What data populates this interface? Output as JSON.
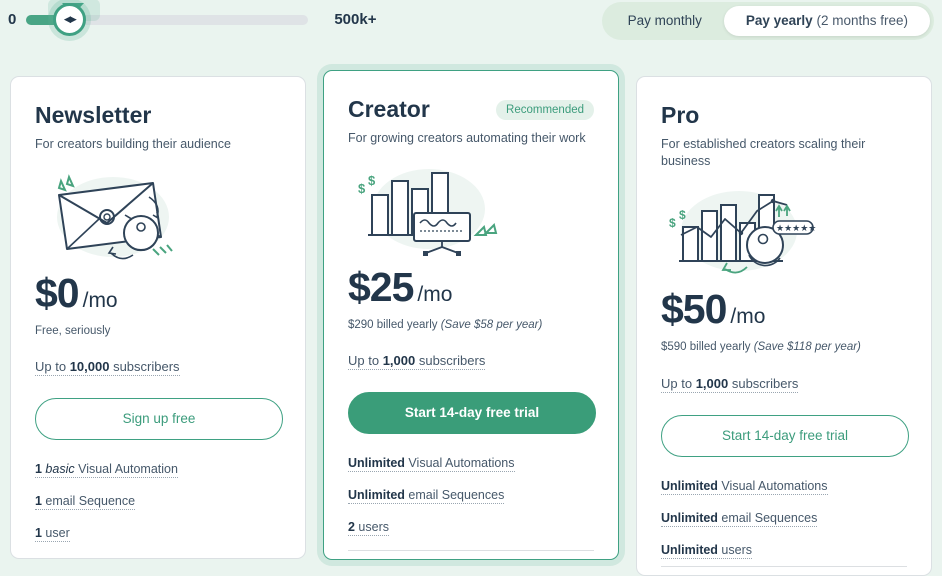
{
  "slider": {
    "min_label": "0",
    "max_label": "500k+",
    "thumb_icon": "drag-handle-arrows",
    "value_percent": 15
  },
  "billing_toggle": {
    "monthly_label": "Pay monthly",
    "yearly_label": "Pay yearly",
    "yearly_note": "(2 months free)",
    "selected": "yearly"
  },
  "colors": {
    "brand_green": "#3a9d79",
    "accent_light": "#e4f1ea",
    "page_bg": "#eaf4ef",
    "text_dark": "#22364a",
    "text_muted": "#46586a"
  },
  "plans": [
    {
      "name": "Newsletter",
      "badge": "",
      "description": "For creators building their audience",
      "illustration": "envelope-illustration",
      "price": "$0",
      "period": "/mo",
      "billing_note_plain": "Free, seriously",
      "billing_note_italic": "",
      "subscribers_prefix": "Up to ",
      "subscribers_count": "10,000",
      "subscribers_suffix": " subscribers",
      "cta_label": "Sign up free",
      "cta_style": "outline",
      "features": [
        {
          "bold": "1",
          "italic": " basic ",
          "rest": "Visual Automation"
        },
        {
          "bold": "1",
          "italic": "",
          "rest": " email Sequence"
        },
        {
          "bold": "1",
          "italic": "",
          "rest": " user"
        }
      ]
    },
    {
      "name": "Creator",
      "badge": "Recommended",
      "description": "For growing creators automating their work",
      "illustration": "bar-chart-monitor-illustration",
      "price": "$25",
      "period": "/mo",
      "billing_note_plain": "$290 billed yearly ",
      "billing_note_italic": "(Save $58 per year)",
      "subscribers_prefix": "Up to ",
      "subscribers_count": "1,000",
      "subscribers_suffix": " subscribers",
      "cta_label": "Start 14-day free trial",
      "cta_style": "primary",
      "features": [
        {
          "bold": "Unlimited",
          "italic": "",
          "rest": " Visual Automations"
        },
        {
          "bold": "Unlimited",
          "italic": "",
          "rest": " email Sequences"
        },
        {
          "bold": "2",
          "italic": "",
          "rest": " users"
        }
      ]
    },
    {
      "name": "Pro",
      "badge": "",
      "description": "For established creators scaling their business",
      "illustration": "growth-chart-audience-illustration",
      "price": "$50",
      "period": "/mo",
      "billing_note_plain": "$590 billed yearly ",
      "billing_note_italic": "(Save $118 per year)",
      "subscribers_prefix": "Up to ",
      "subscribers_count": "1,000",
      "subscribers_suffix": " subscribers",
      "cta_label": "Start 14-day free trial",
      "cta_style": "outline",
      "features": [
        {
          "bold": "Unlimited",
          "italic": "",
          "rest": " Visual Automations"
        },
        {
          "bold": "Unlimited",
          "italic": "",
          "rest": " email Sequences"
        },
        {
          "bold": "Unlimited",
          "italic": "",
          "rest": " users"
        }
      ]
    }
  ]
}
